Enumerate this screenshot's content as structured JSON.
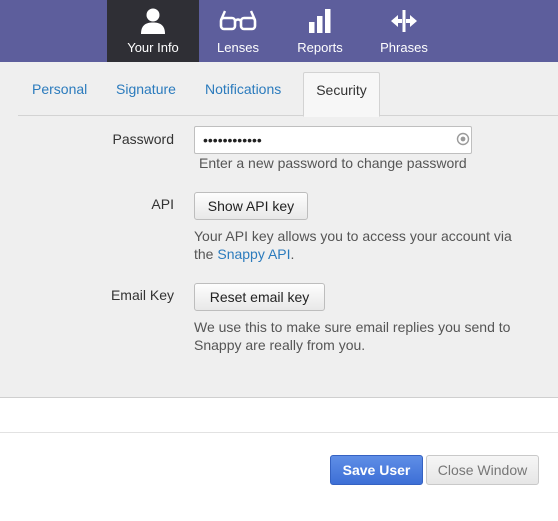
{
  "nav": {
    "items": [
      {
        "label": "Your Info",
        "icon": "person-icon",
        "active": true
      },
      {
        "label": "Lenses",
        "icon": "glasses-icon",
        "active": false
      },
      {
        "label": "Reports",
        "icon": "bar-chart-icon",
        "active": false
      },
      {
        "label": "Phrases",
        "icon": "arrows-horizontal-icon",
        "active": false
      }
    ]
  },
  "tabs": [
    {
      "label": "Personal",
      "active": false
    },
    {
      "label": "Signature",
      "active": false
    },
    {
      "label": "Notifications",
      "active": false
    },
    {
      "label": "Security",
      "active": true
    }
  ],
  "security": {
    "password_label": "Password",
    "password_value": "••••••••••••",
    "password_hint": "Enter a new password to change password",
    "api_label": "API",
    "api_button": "Show API key",
    "api_hint_prefix": "Your API key allows you to access your account via",
    "api_hint_the": "the",
    "api_hint_link": "Snappy API",
    "api_hint_suffix": ".",
    "email_key_label": "Email Key",
    "email_key_button": "Reset email key",
    "email_key_hint_line1": "We use this to make sure email replies you send to",
    "email_key_hint_line2": "Snappy are really from you."
  },
  "footer": {
    "save_label": "Save User",
    "close_label": "Close Window"
  },
  "colors": {
    "nav_bg": "#5d5e9c",
    "nav_active_bg": "#2f2f35",
    "link": "#2b7bbd",
    "primary_button": "#4a7bdc"
  }
}
